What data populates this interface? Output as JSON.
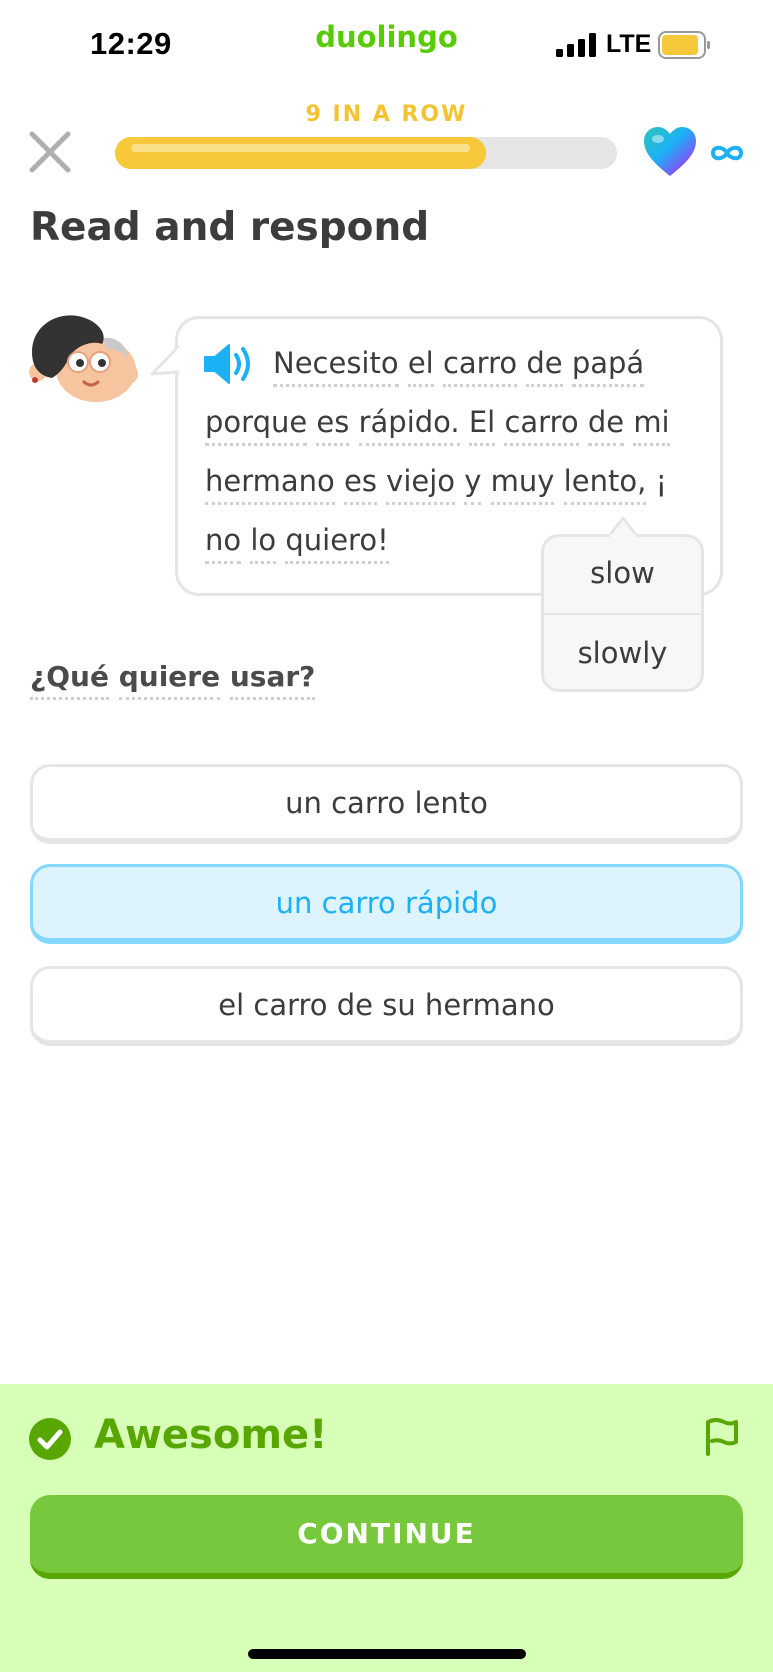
{
  "status_bar": {
    "time": "12:29",
    "app_brand": "duolingo",
    "network": "LTE"
  },
  "header": {
    "streak_label": "9 IN A ROW",
    "progress_fraction": 0.74,
    "hearts": "∞"
  },
  "lesson": {
    "title": "Read and respond",
    "passage_lines": [
      [
        "Necesito",
        "el",
        "carro",
        "de",
        "papá"
      ],
      [
        "porque",
        "es",
        "rápido.",
        "El",
        "carro",
        "de",
        "mi"
      ],
      [
        "hermano",
        "es",
        "viejo",
        "y",
        "muy",
        "lento,",
        "¡"
      ],
      [
        "no",
        "lo",
        "quiero!"
      ]
    ],
    "hint_tooltip": {
      "word": "lento,",
      "options": [
        "slow",
        "slowly"
      ]
    },
    "question": [
      "¿Qué",
      "quiere",
      "usar?"
    ],
    "answers": [
      {
        "label": "un carro lento",
        "selected": false
      },
      {
        "label": "un carro rápido",
        "selected": true
      },
      {
        "label": "el carro de su hermano",
        "selected": false
      }
    ]
  },
  "feedback": {
    "message": "Awesome!",
    "continue_label": "CONTINUE"
  },
  "colors": {
    "brand_green": "#58cc02",
    "streak_yellow": "#f7c93a",
    "selected_blue": "#1cb0f6",
    "feedback_bg": "#d7ffb8",
    "continue_green": "#78c83d"
  },
  "icons": {
    "close": "close-icon",
    "heart": "heart-icon",
    "infinity": "infinity-icon",
    "speaker": "speaker-icon",
    "check": "check-circle-icon",
    "flag": "flag-icon"
  }
}
